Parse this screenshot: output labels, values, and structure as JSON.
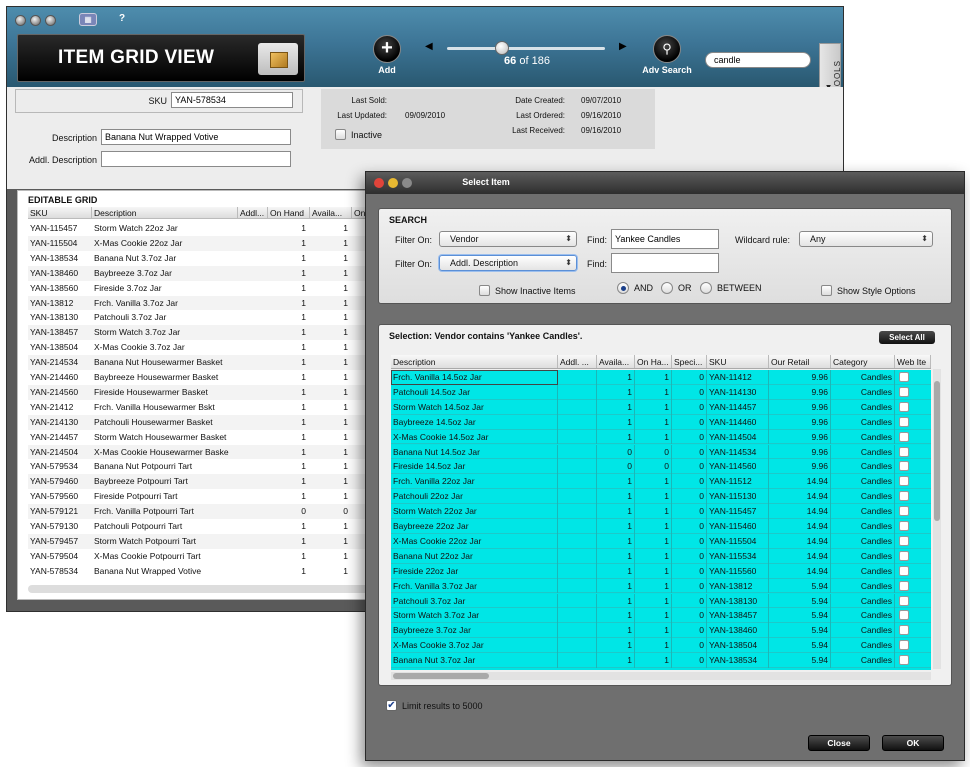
{
  "window": {
    "title": "ITEM GRID VIEW",
    "help_label": "?",
    "grid_icon_glyph": "▦"
  },
  "toolbar": {
    "add_label": "Add",
    "record_current": "66",
    "record_of": "of 186",
    "adv_search_label": "Adv Search",
    "search_value": "candle",
    "tools_label": "▲ TOOLS"
  },
  "form": {
    "sku_label": "SKU",
    "sku_value": "YAN-578534",
    "description_label": "Description",
    "description_value": "Banana Nut Wrapped Votive",
    "addl_description_label": "Addl. Description",
    "addl_description_value": "",
    "last_sold_label": "Last Sold:",
    "last_sold_value": "",
    "last_updated_label": "Last Updated:",
    "last_updated_value": "09/09/2010",
    "inactive_label": "Inactive",
    "date_created_label": "Date Created:",
    "date_created_value": "09/07/2010",
    "last_ordered_label": "Last Ordered:",
    "last_ordered_value": "09/16/2010",
    "last_received_label": "Last Received:",
    "last_received_value": "09/16/2010"
  },
  "grid": {
    "title": "EDITABLE GRID",
    "columns": [
      "SKU",
      "Description",
      "Addl...",
      "On Hand",
      "Availa...",
      "On"
    ],
    "rows": [
      {
        "sku": "YAN-115457",
        "desc": "Storm Watch 22oz Jar",
        "onhand": "1",
        "avail": "1"
      },
      {
        "sku": "YAN-115504",
        "desc": "X-Mas Cookie 22oz Jar",
        "onhand": "1",
        "avail": "1"
      },
      {
        "sku": "YAN-138534",
        "desc": "Banana Nut 3.7oz Jar",
        "onhand": "1",
        "avail": "1"
      },
      {
        "sku": "YAN-138460",
        "desc": "Baybreeze 3.7oz Jar",
        "onhand": "1",
        "avail": "1"
      },
      {
        "sku": "YAN-138560",
        "desc": "Fireside 3.7oz Jar",
        "onhand": "1",
        "avail": "1"
      },
      {
        "sku": "YAN-13812",
        "desc": "Frch. Vanilla 3.7oz Jar",
        "onhand": "1",
        "avail": "1"
      },
      {
        "sku": "YAN-138130",
        "desc": "Patchouli 3.7oz Jar",
        "onhand": "1",
        "avail": "1"
      },
      {
        "sku": "YAN-138457",
        "desc": "Storm Watch 3.7oz Jar",
        "onhand": "1",
        "avail": "1"
      },
      {
        "sku": "YAN-138504",
        "desc": "X-Mas Cookie 3.7oz Jar",
        "onhand": "1",
        "avail": "1"
      },
      {
        "sku": "YAN-214534",
        "desc": "Banana Nut Housewarmer Basket",
        "onhand": "1",
        "avail": "1"
      },
      {
        "sku": "YAN-214460",
        "desc": "Baybreeze Housewarmer Basket",
        "onhand": "1",
        "avail": "1"
      },
      {
        "sku": "YAN-214560",
        "desc": "Fireside Housewarmer Basket",
        "onhand": "1",
        "avail": "1"
      },
      {
        "sku": "YAN-21412",
        "desc": "Frch. Vanilla Housewarmer Bskt",
        "onhand": "1",
        "avail": "1"
      },
      {
        "sku": "YAN-214130",
        "desc": "Patchouli Housewarmer Basket",
        "onhand": "1",
        "avail": "1"
      },
      {
        "sku": "YAN-214457",
        "desc": "Storm Watch Housewarmer Basket",
        "onhand": "1",
        "avail": "1"
      },
      {
        "sku": "YAN-214504",
        "desc": "X-Mas Cookie Housewarmer Baske",
        "onhand": "1",
        "avail": "1"
      },
      {
        "sku": "YAN-579534",
        "desc": "Banana Nut Potpourri Tart",
        "onhand": "1",
        "avail": "1"
      },
      {
        "sku": "YAN-579460",
        "desc": "Baybreeze Potpourri Tart",
        "onhand": "1",
        "avail": "1"
      },
      {
        "sku": "YAN-579560",
        "desc": "Fireside Potpourri Tart",
        "onhand": "1",
        "avail": "1"
      },
      {
        "sku": "YAN-579121",
        "desc": "Frch. Vanilla Potpourri Tart",
        "onhand": "0",
        "avail": "0"
      },
      {
        "sku": "YAN-579130",
        "desc": "Patchouli Potpourri Tart",
        "onhand": "1",
        "avail": "1"
      },
      {
        "sku": "YAN-579457",
        "desc": "Storm Watch Potpourri Tart",
        "onhand": "1",
        "avail": "1"
      },
      {
        "sku": "YAN-579504",
        "desc": "X-Mas Cookie Potpourri Tart",
        "onhand": "1",
        "avail": "1"
      },
      {
        "sku": "YAN-578534",
        "desc": "Banana Nut Wrapped Votive",
        "onhand": "1",
        "avail": "1"
      }
    ]
  },
  "dialog": {
    "title": "Select Item",
    "search_heading": "SEARCH",
    "filter_on_label": "Filter On:",
    "filter1_value": "Vendor",
    "find_label": "Find:",
    "find1_value": "Yankee Candles",
    "wildcard_label": "Wildcard rule:",
    "wildcard_value": "Any",
    "filter2_value": "Addl. Description",
    "find2_value": "",
    "show_inactive_label": "Show Inactive Items",
    "and_label": "AND",
    "or_label": "OR",
    "between_label": "BETWEEN",
    "show_style_label": "Show Style Options",
    "selection_caption": "Selection: Vendor contains 'Yankee Candles'.",
    "select_all_label": "Select All",
    "columns": [
      "Description",
      "Addl. ...",
      "Availa...",
      "On Ha...",
      "Speci...",
      "SKU",
      "Our Retail",
      "Category",
      "Web Ite"
    ],
    "rows": [
      {
        "desc": "Frch. Vanilla 14.5oz Jar",
        "avail": "1",
        "onhand": "1",
        "spec": "0",
        "sku": "YAN-11412",
        "retail": "9.96",
        "cat": "Candles"
      },
      {
        "desc": "Patchouli 14.5oz Jar",
        "avail": "1",
        "onhand": "1",
        "spec": "0",
        "sku": "YAN-114130",
        "retail": "9.96",
        "cat": "Candles"
      },
      {
        "desc": "Storm Watch 14.5oz Jar",
        "avail": "1",
        "onhand": "1",
        "spec": "0",
        "sku": "YAN-114457",
        "retail": "9.96",
        "cat": "Candles"
      },
      {
        "desc": "Baybreeze 14.5oz Jar",
        "avail": "1",
        "onhand": "1",
        "spec": "0",
        "sku": "YAN-114460",
        "retail": "9.96",
        "cat": "Candles"
      },
      {
        "desc": "X-Mas Cookie 14.5oz Jar",
        "avail": "1",
        "onhand": "1",
        "spec": "0",
        "sku": "YAN-114504",
        "retail": "9.96",
        "cat": "Candles"
      },
      {
        "desc": "Banana Nut 14.5oz Jar",
        "avail": "0",
        "onhand": "0",
        "spec": "0",
        "sku": "YAN-114534",
        "retail": "9.96",
        "cat": "Candles"
      },
      {
        "desc": "Fireside 14.5oz Jar",
        "avail": "0",
        "onhand": "0",
        "spec": "0",
        "sku": "YAN-114560",
        "retail": "9.96",
        "cat": "Candles"
      },
      {
        "desc": "Frch. Vanilla 22oz Jar",
        "avail": "1",
        "onhand": "1",
        "spec": "0",
        "sku": "YAN-11512",
        "retail": "14.94",
        "cat": "Candles"
      },
      {
        "desc": "Patchouli 22oz Jar",
        "avail": "1",
        "onhand": "1",
        "spec": "0",
        "sku": "YAN-115130",
        "retail": "14.94",
        "cat": "Candles"
      },
      {
        "desc": "Storm Watch 22oz Jar",
        "avail": "1",
        "onhand": "1",
        "spec": "0",
        "sku": "YAN-115457",
        "retail": "14.94",
        "cat": "Candles"
      },
      {
        "desc": "Baybreeze 22oz Jar",
        "avail": "1",
        "onhand": "1",
        "spec": "0",
        "sku": "YAN-115460",
        "retail": "14.94",
        "cat": "Candles"
      },
      {
        "desc": "X-Mas Cookie 22oz Jar",
        "avail": "1",
        "onhand": "1",
        "spec": "0",
        "sku": "YAN-115504",
        "retail": "14.94",
        "cat": "Candles"
      },
      {
        "desc": "Banana Nut 22oz Jar",
        "avail": "1",
        "onhand": "1",
        "spec": "0",
        "sku": "YAN-115534",
        "retail": "14.94",
        "cat": "Candles"
      },
      {
        "desc": "Fireside 22oz Jar",
        "avail": "1",
        "onhand": "1",
        "spec": "0",
        "sku": "YAN-115560",
        "retail": "14.94",
        "cat": "Candles"
      },
      {
        "desc": "Frch. Vanilla 3.7oz Jar",
        "avail": "1",
        "onhand": "1",
        "spec": "0",
        "sku": "YAN-13812",
        "retail": "5.94",
        "cat": "Candles"
      },
      {
        "desc": "Patchouli 3.7oz Jar",
        "avail": "1",
        "onhand": "1",
        "spec": "0",
        "sku": "YAN-138130",
        "retail": "5.94",
        "cat": "Candles"
      },
      {
        "desc": "Storm Watch 3.7oz Jar",
        "avail": "1",
        "onhand": "1",
        "spec": "0",
        "sku": "YAN-138457",
        "retail": "5.94",
        "cat": "Candles"
      },
      {
        "desc": "Baybreeze 3.7oz Jar",
        "avail": "1",
        "onhand": "1",
        "spec": "0",
        "sku": "YAN-138460",
        "retail": "5.94",
        "cat": "Candles"
      },
      {
        "desc": "X-Mas Cookie 3.7oz Jar",
        "avail": "1",
        "onhand": "1",
        "spec": "0",
        "sku": "YAN-138504",
        "retail": "5.94",
        "cat": "Candles"
      },
      {
        "desc": "Banana Nut 3.7oz Jar",
        "avail": "1",
        "onhand": "1",
        "spec": "0",
        "sku": "YAN-138534",
        "retail": "5.94",
        "cat": "Candles"
      }
    ],
    "limit_label": "Limit results to 5000",
    "close_label": "Close",
    "ok_label": "OK"
  },
  "colors": {
    "toolbar": "#3d7596",
    "selection_row": "#00e6e6",
    "close_light": "#e0443a",
    "min_light": "#e8b932",
    "max_light": "#8a8a8a"
  }
}
